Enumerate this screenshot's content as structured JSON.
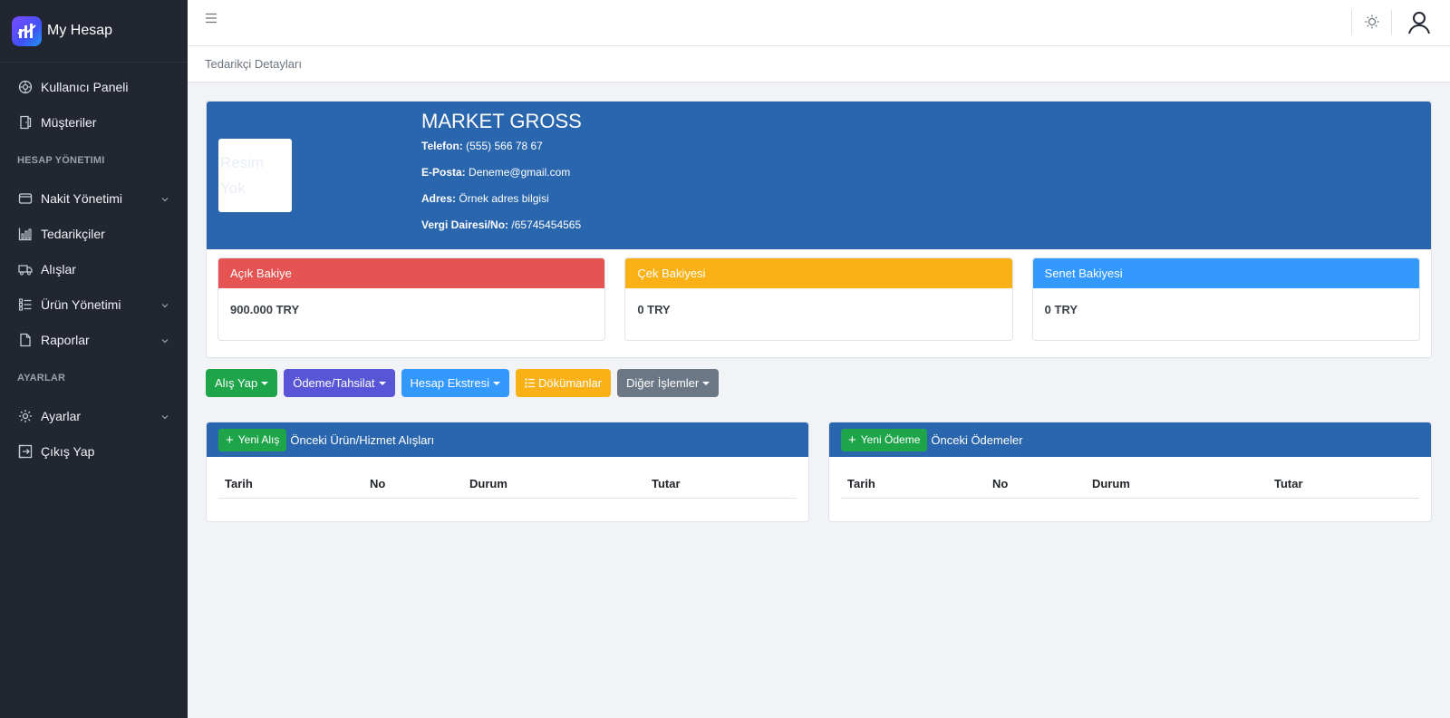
{
  "brand": {
    "name": "My Hesap"
  },
  "sidebar": {
    "items": [
      {
        "label": "Kullanıcı Paneli",
        "icon": "dashboard-icon"
      },
      {
        "label": "Müşteriler",
        "icon": "door-icon"
      }
    ],
    "section1_title": "HESAP YÖNETIMI",
    "section1_items": [
      {
        "label": "Nakit Yönetimi",
        "icon": "wallet-icon",
        "expandable": true
      },
      {
        "label": "Tedarikçiler",
        "icon": "chart-bar-icon",
        "expandable": false
      },
      {
        "label": "Alışlar",
        "icon": "truck-icon",
        "expandable": false
      },
      {
        "label": "Ürün Yönetimi",
        "icon": "list-icon",
        "expandable": true
      },
      {
        "label": "Raporlar",
        "icon": "file-icon",
        "expandable": true
      }
    ],
    "section2_title": "AYARLAR",
    "section2_items": [
      {
        "label": "Ayarlar",
        "icon": "gear-icon",
        "expandable": true
      },
      {
        "label": "Çıkış Yap",
        "icon": "logout-icon",
        "expandable": false
      }
    ]
  },
  "header": {
    "menu_icon": "hamburger-icon",
    "theme_icon": "sun-icon",
    "user_icon": "user-icon"
  },
  "breadcrumb": "Tedarikçi Detayları",
  "supplier": {
    "name": "MARKET GROSS",
    "photo_placeholder_line1": "Resim",
    "photo_placeholder_line2": "Yok",
    "phone_label": "Telefon:",
    "phone": "(555) 566 78 67",
    "email_label": "E-Posta:",
    "email": "Deneme@gmail.com",
    "address_label": "Adres:",
    "address": "Örnek adres bilgisi",
    "tax_label": "Vergi Dairesi/No:",
    "tax": "/65745454565"
  },
  "balances": [
    {
      "title": "Açık Bakiye",
      "value": "900.000 TRY",
      "color": "#e55353"
    },
    {
      "title": "Çek Bakiyesi",
      "value": "0 TRY",
      "color": "#f9b115"
    },
    {
      "title": "Senet Bakiyesi",
      "value": "0 TRY",
      "color": "#3399ff"
    }
  ],
  "actions": [
    {
      "label": "Alış Yap",
      "color": "#1ea449",
      "dropdown": true
    },
    {
      "label": "Ödeme/Tahsilat",
      "color": "#5856d6",
      "dropdown": true
    },
    {
      "label": "Hesap Ekstresi",
      "color": "#3399ff",
      "dropdown": true
    },
    {
      "label": "Dökümanlar",
      "color": "#f9b115",
      "dropdown": false,
      "icon": "list-icon"
    },
    {
      "label": "Diğer İşlemler",
      "color": "#6b7785",
      "dropdown": true
    }
  ],
  "purchases": {
    "new_label": "Yeni Alış",
    "title": "Önceki Ürün/Hizmet Alışları",
    "columns": [
      "Tarih",
      "No",
      "Durum",
      "Tutar"
    ]
  },
  "payments": {
    "new_label": "Yeni Ödeme",
    "title": "Önceki Ödemeler",
    "columns": [
      "Tarih",
      "No",
      "Durum",
      "Tutar"
    ]
  }
}
